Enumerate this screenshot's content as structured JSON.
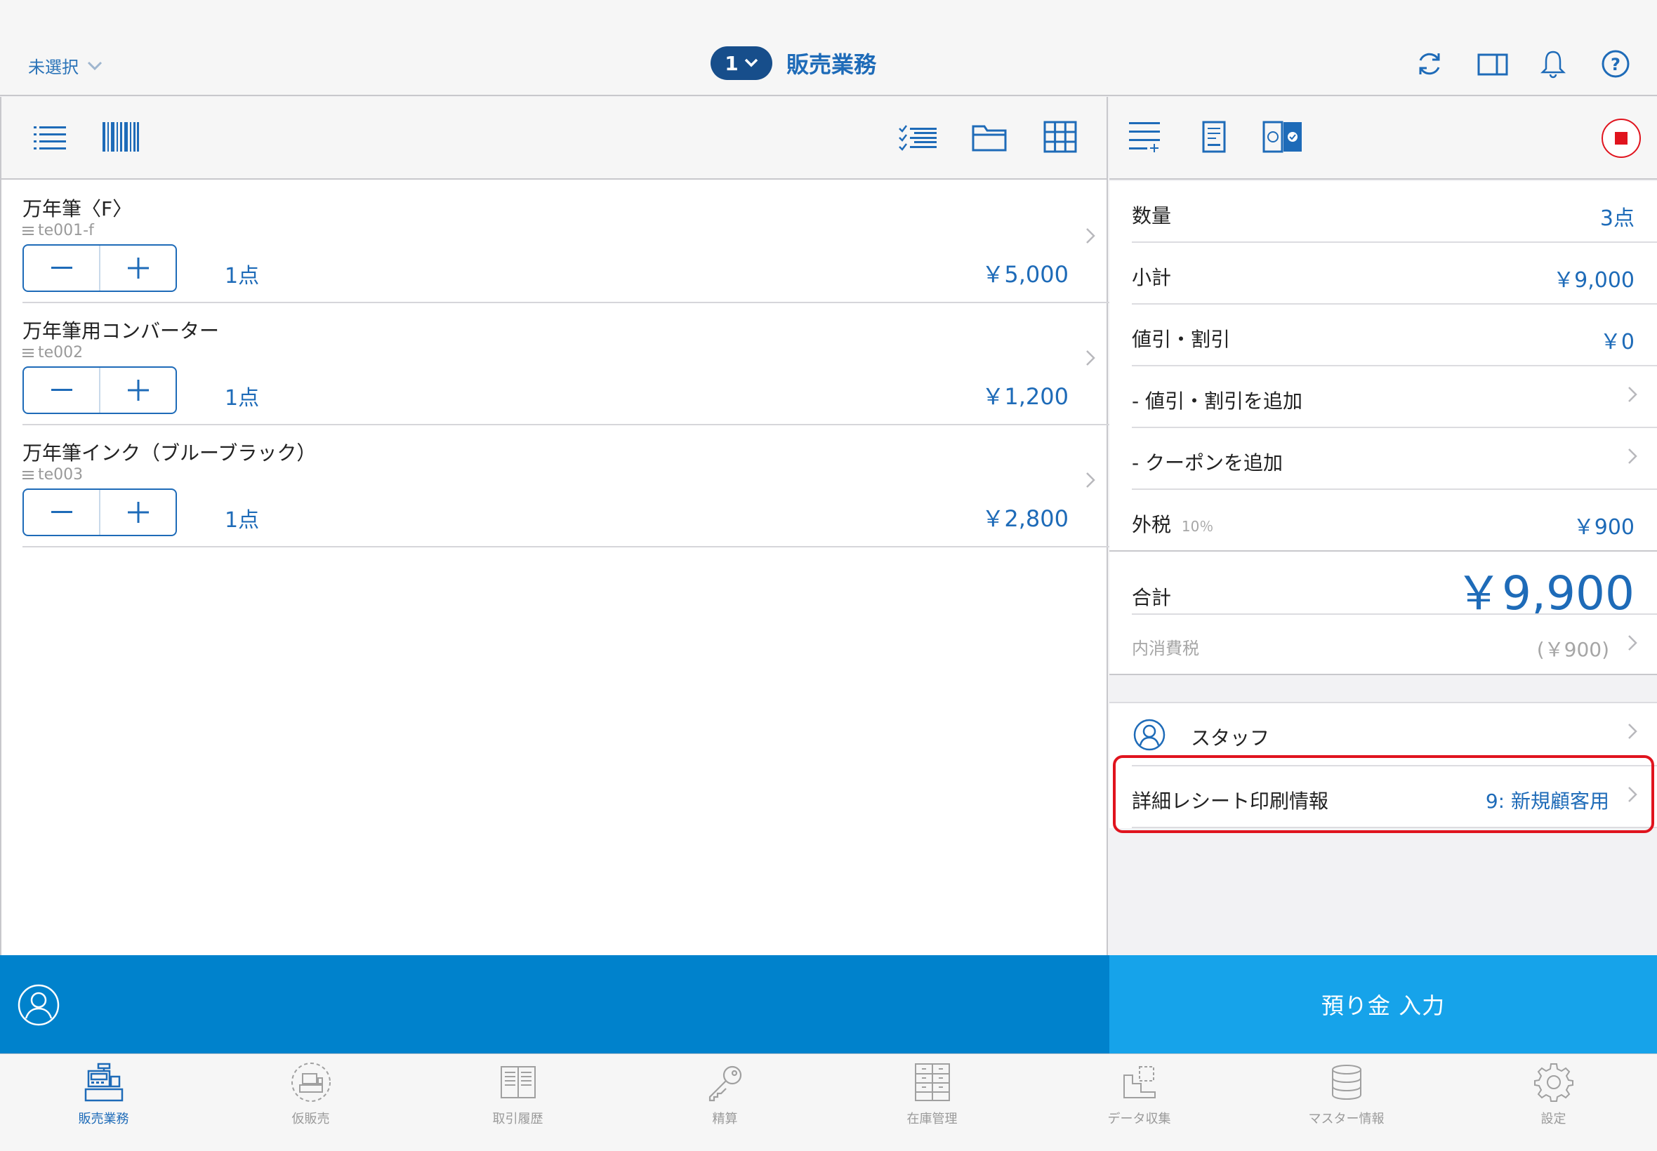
{
  "header": {
    "selector_label": "未選択",
    "register_number": "1",
    "title": "販売業務"
  },
  "items": [
    {
      "name": "万年筆〈F〉",
      "code": "te001-f",
      "qty": "1点",
      "price": "￥5,000"
    },
    {
      "name": "万年筆用コンバーター",
      "code": "te002",
      "qty": "1点",
      "price": "￥1,200"
    },
    {
      "name": "万年筆インク（ブルーブラック）",
      "code": "te003",
      "qty": "1点",
      "price": "￥2,800"
    }
  ],
  "summary": {
    "quantity_label": "数量",
    "quantity_value": "3点",
    "subtotal_label": "小計",
    "subtotal_value": "￥9,000",
    "discount_label": "値引・割引",
    "discount_value": "￥0",
    "add_discount_label": "- 値引・割引を追加",
    "add_coupon_label": "- クーポンを追加",
    "tax_label": "外税",
    "tax_rate": "10％",
    "tax_value": "￥900",
    "total_label": "合計",
    "total_value": "￥9,900",
    "inner_tax_label": "内消費税",
    "inner_tax_value": "(￥900)"
  },
  "staff": {
    "label": "スタッフ"
  },
  "receipt": {
    "label": "詳細レシート印刷情報",
    "value": "9: 新規顧客用"
  },
  "pay_button": "預り金 入力",
  "tabs": [
    {
      "label": "販売業務",
      "icon": "register-icon",
      "active": true
    },
    {
      "label": "仮販売",
      "icon": "temp-sale-icon",
      "active": false
    },
    {
      "label": "取引履歴",
      "icon": "history-book-icon",
      "active": false
    },
    {
      "label": "精算",
      "icon": "key-icon",
      "active": false
    },
    {
      "label": "在庫管理",
      "icon": "inventory-icon",
      "active": false
    },
    {
      "label": "データ収集",
      "icon": "data-collect-icon",
      "active": false
    },
    {
      "label": "マスター情報",
      "icon": "database-icon",
      "active": false
    },
    {
      "label": "設定",
      "icon": "gear-icon",
      "active": false
    }
  ],
  "colors": {
    "accent": "#1e6bb8",
    "customer_bar": "#0082cc",
    "pay_button": "#16a3ea",
    "highlight": "#e0141e"
  }
}
